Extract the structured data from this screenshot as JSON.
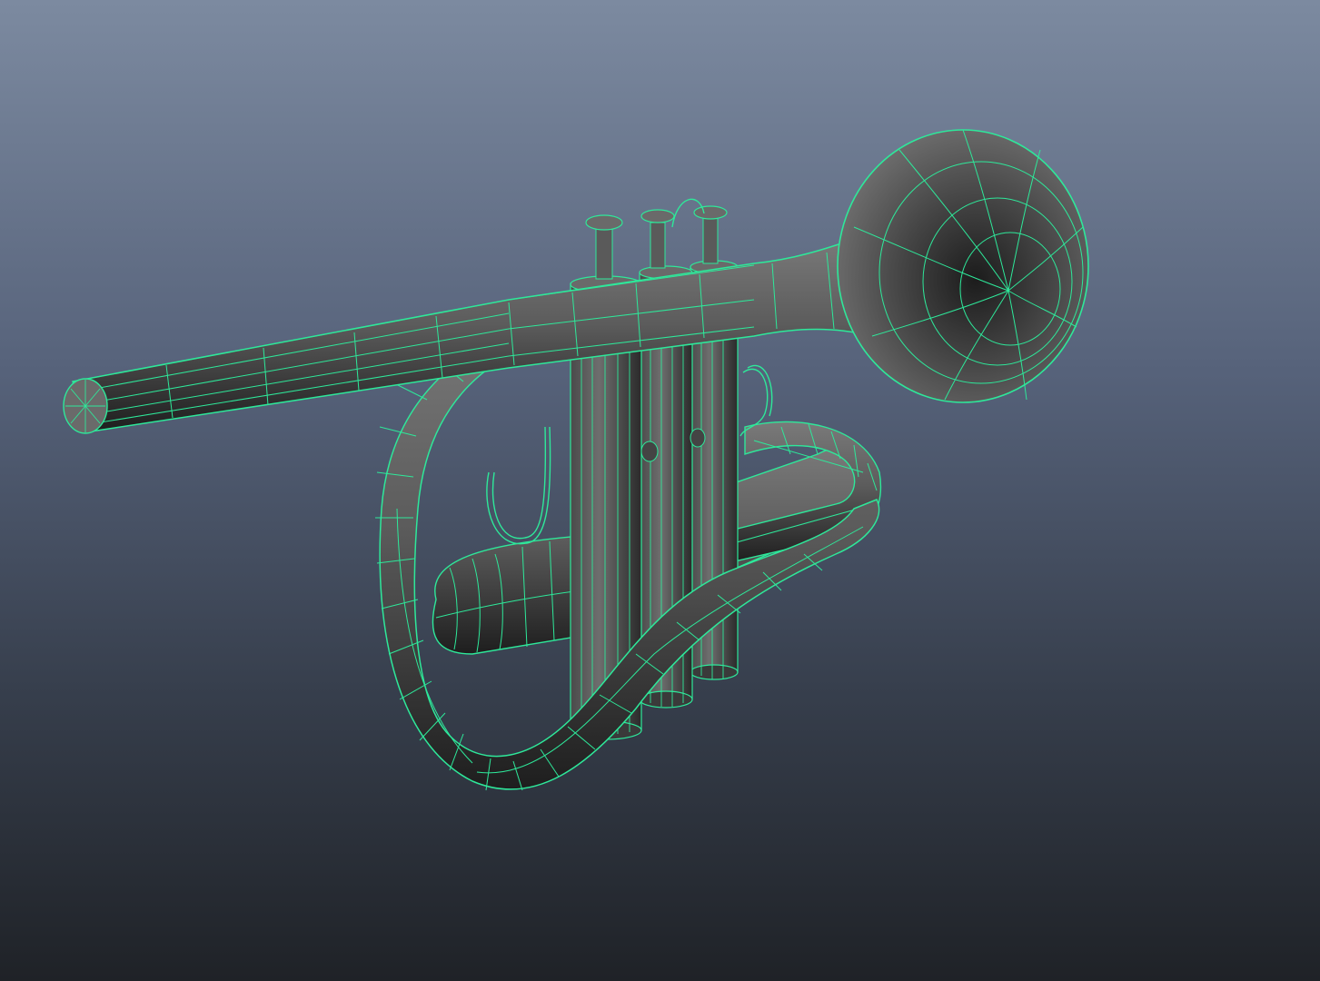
{
  "viewport": {
    "background_top": "#7c8aa0",
    "background_bottom": "#1f2227"
  },
  "model": {
    "object": "trumpet-icon",
    "display_mode": "wireframe-on-shaded",
    "wire_color": "#2ee89a",
    "surface_color": "#5e5e5e",
    "surface_dark": "#1e1e1e",
    "surface_light": "#7a7a7a"
  }
}
